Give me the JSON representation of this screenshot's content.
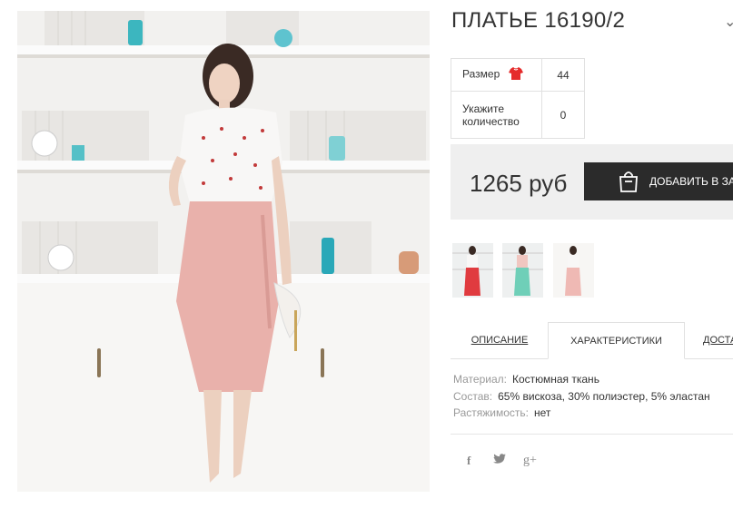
{
  "product": {
    "title": "ПЛАТЬЕ 16190/2",
    "title_chevron": "⌄"
  },
  "options": {
    "size_label": "Размер",
    "size_value": "44",
    "qty_label": "Укажите количество",
    "qty_value": "0",
    "size_icon": "red-shirt-icon",
    "size_icon_color": "#e52b2b"
  },
  "purchase": {
    "price": "1265 руб",
    "add_to_cart": "ДОБАВИТЬ В ЗАКАЗ",
    "cart_icon": "shopping-bag-icon"
  },
  "thumbnails": [
    {
      "name": "thumb-red-skirt",
      "skirt": "#e03b3f"
    },
    {
      "name": "thumb-mint-skirt",
      "skirt": "#6fcfb8"
    },
    {
      "name": "thumb-pink-skirt",
      "skirt": "#efb9b4"
    }
  ],
  "tabs": [
    {
      "label": "ОПИСАНИЕ",
      "active": false
    },
    {
      "label": "ХАРАКТЕРИСТИКИ",
      "active": true
    },
    {
      "label": "ДОСТАВКА",
      "active": false
    }
  ],
  "specs": [
    {
      "key": "Материал:",
      "value": "Костюмная ткань"
    },
    {
      "key": "Состав:",
      "value": "65% вискоза, 30% полиэстер, 5% эластан"
    },
    {
      "key": "Растяжимость:",
      "value": "нет"
    }
  ],
  "social": [
    {
      "name": "facebook-icon",
      "glyph": "f"
    },
    {
      "name": "twitter-icon",
      "glyph": "𝕥"
    },
    {
      "name": "google-plus-icon",
      "glyph": "g+"
    }
  ],
  "colors": {
    "accent_dark": "#2b2b2b",
    "price_bg": "#efefef",
    "skirt_pink": "#e9b1ab",
    "shelf_white": "#f6f5f3"
  }
}
